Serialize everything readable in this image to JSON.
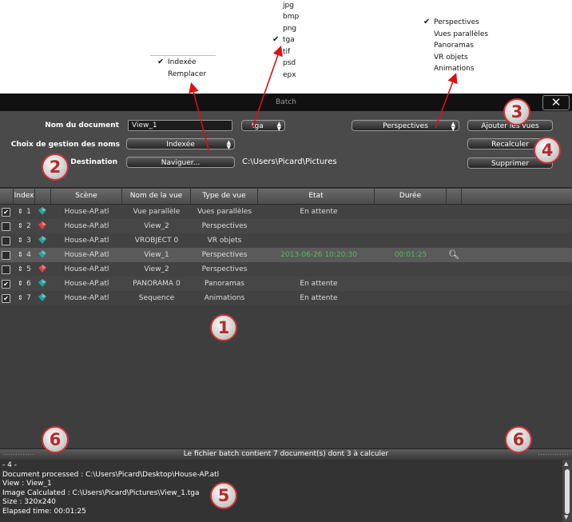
{
  "menus": {
    "format": {
      "items": [
        "jpg",
        "bmp",
        "png",
        "tga",
        "tif",
        "psd",
        "epx"
      ],
      "selected": "tga"
    },
    "gestion": {
      "items": [
        "Indexée",
        "Remplacer"
      ],
      "selected": "Indexée"
    },
    "vues": {
      "items": [
        "Perspectives",
        "Vues parallèles",
        "Panoramas",
        "VR objets",
        "Animations"
      ],
      "selected": "Perspectives"
    }
  },
  "window": {
    "title": "Batch",
    "close": "✕"
  },
  "form": {
    "doc_label": "Nom du document",
    "doc_value": "View_1",
    "format_value": "tga",
    "vues_value": "Perspectives",
    "add_views": "Ajouter les vues",
    "gestion_label": "Choix de gestion des noms",
    "gestion_value": "Indexée",
    "recalc": "Recalculer",
    "dest_label": "Destination",
    "browse": "Naviguer...",
    "path": "C:\\Users\\Picard\\Pictures",
    "delete": "Supprimer"
  },
  "table": {
    "headers": [
      "Index",
      "Scène",
      "Nom de la vue",
      "Type de vue",
      "Etat",
      "Durée"
    ],
    "rows": [
      {
        "checked": true,
        "index": "1",
        "gem": "green",
        "scene": "House-AP.atl",
        "view": "Vue parallèle",
        "type": "Vues parallèles",
        "state": "En attente",
        "duration": "",
        "active": false
      },
      {
        "checked": false,
        "index": "2",
        "gem": "red",
        "scene": "House-AP.atl",
        "view": "View_2",
        "type": "Perspectives",
        "state": "",
        "duration": "",
        "active": false
      },
      {
        "checked": false,
        "index": "3",
        "gem": "green",
        "scene": "House-AP.atl",
        "view": "VROBJECT 0",
        "type": "VR objets",
        "state": "",
        "duration": "",
        "active": false
      },
      {
        "checked": false,
        "index": "4",
        "gem": "green",
        "scene": "House-AP.atl",
        "view": "View_1",
        "type": "Perspectives",
        "state": "2013-06-26 10:20:30",
        "duration": "00:01:25",
        "active": true
      },
      {
        "checked": false,
        "index": "5",
        "gem": "red",
        "scene": "House-AP.atl",
        "view": "View_2",
        "type": "Perspectives",
        "state": "",
        "duration": "",
        "active": false
      },
      {
        "checked": true,
        "index": "6",
        "gem": "green",
        "scene": "House-AP.atl",
        "view": "PANORAMA 0",
        "type": "Panoramas",
        "state": "En attente",
        "duration": "",
        "active": false
      },
      {
        "checked": true,
        "index": "7",
        "gem": "green",
        "scene": "House-AP.atl",
        "view": "Sequence",
        "type": "Animations",
        "state": "En attente",
        "duration": "",
        "active": false
      }
    ]
  },
  "status": "Le fichier batch contient 7 document(s) dont 3 à calculer",
  "log": [
    "- 4 -",
    "Document processed : C:\\Users\\Picard\\Desktop\\House-AP.atl",
    "View : View_1",
    "Image Calculated : C:\\Users\\Picard\\Pictures\\View_1.tga",
    "Size : 320x240",
    "Elapsed time: 00:01:25"
  ],
  "badges": [
    "1",
    "2",
    "3",
    "4",
    "5",
    "6",
    "6"
  ],
  "colors": {
    "accent_green": "#4fbf56",
    "arrow_red": "#d11",
    "badge_border": "#c33"
  }
}
